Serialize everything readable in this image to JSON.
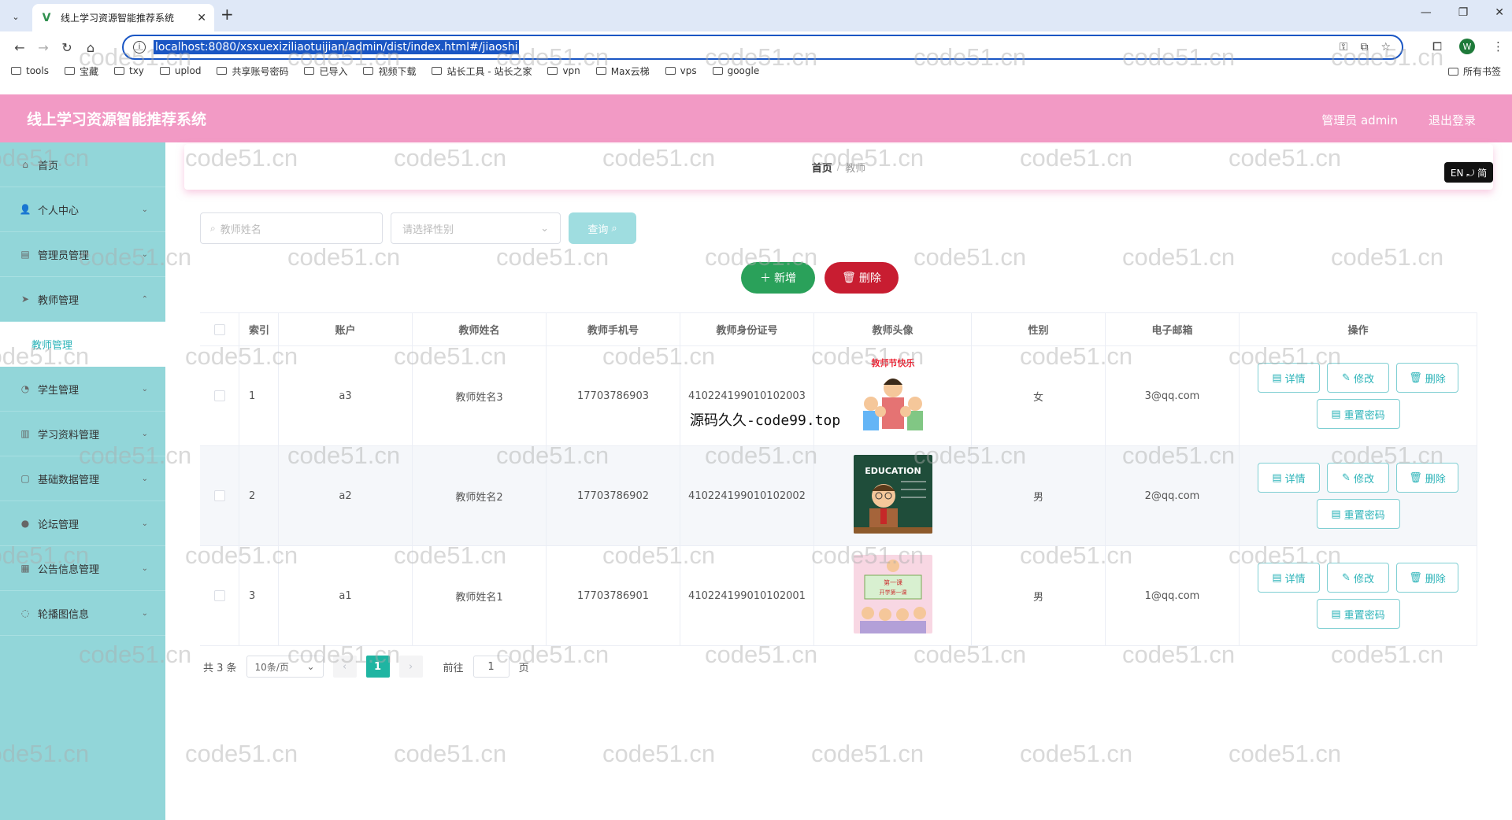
{
  "browser": {
    "tab_title": "线上学习资源智能推荐系统",
    "url": "localhost:8080/xsxuexiziliaotuijian/admin/dist/index.html#/jiaoshi",
    "bookmarks": [
      "tools",
      "宝藏",
      "txy",
      "uplod",
      "共享账号密码",
      "已导入",
      "视频下载",
      "站长工具 - 站长之家",
      "vpn",
      "Max云梯",
      "vps",
      "google"
    ],
    "bookmarks_right": "所有书签",
    "profile_initial": "W"
  },
  "header": {
    "title": "线上学习资源智能推荐系统",
    "user": "管理员 admin",
    "logout": "退出登录"
  },
  "sidebar": {
    "items": [
      {
        "label": "首页",
        "icon": "home-icon"
      },
      {
        "label": "个人中心",
        "icon": "user-icon"
      },
      {
        "label": "管理员管理",
        "icon": "admin-icon"
      },
      {
        "label": "教师管理",
        "icon": "send-icon"
      },
      {
        "label": "学生管理",
        "icon": "student-icon"
      },
      {
        "label": "学习资料管理",
        "icon": "chart-icon"
      },
      {
        "label": "基础数据管理",
        "icon": "data-icon"
      },
      {
        "label": "论坛管理",
        "icon": "forum-icon"
      },
      {
        "label": "公告信息管理",
        "icon": "notice-icon"
      },
      {
        "label": "轮播图信息",
        "icon": "carousel-icon"
      }
    ],
    "submenu": "教师管理"
  },
  "breadcrumb": {
    "home": "首页",
    "current": "教师"
  },
  "lang_toggle": "EN ⤾ 简",
  "search": {
    "name_placeholder": "教师姓名",
    "gender_placeholder": "请选择性别",
    "query_label": "查询"
  },
  "actions": {
    "add": "新增",
    "delete": "删除"
  },
  "table": {
    "headers": [
      "索引",
      "账户",
      "教师姓名",
      "教师手机号",
      "教师身份证号",
      "教师头像",
      "性别",
      "电子邮箱",
      "操作"
    ],
    "rows": [
      {
        "index": "1",
        "account": "a3",
        "name": "教师姓名3",
        "phone": "17703786903",
        "id_card": "410224199010102003",
        "gender": "女",
        "email": "3@qq.com"
      },
      {
        "index": "2",
        "account": "a2",
        "name": "教师姓名2",
        "phone": "17703786902",
        "id_card": "410224199010102002",
        "gender": "男",
        "email": "2@qq.com"
      },
      {
        "index": "3",
        "account": "a1",
        "name": "教师姓名1",
        "phone": "17703786901",
        "id_card": "410224199010102001",
        "gender": "男",
        "email": "1@qq.com"
      }
    ],
    "op_labels": {
      "detail": "详情",
      "edit": "修改",
      "delete": "删除",
      "reset": "重置密码"
    }
  },
  "pager": {
    "total": "共 3 条",
    "page_size": "10条/页",
    "current": "1",
    "goto_prefix": "前往",
    "goto_value": "1",
    "goto_suffix": "页"
  },
  "overlay_text": "源码久久-code99.top",
  "watermark": "code51.cn"
}
